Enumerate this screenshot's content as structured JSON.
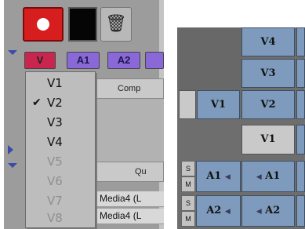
{
  "toolbar": {
    "record_icon": "record-icon",
    "trash_icon": "trash-icon",
    "trash_glyph": "🗑"
  },
  "tracks": {
    "video": "V",
    "audio1": "A1",
    "audio2": "A2"
  },
  "columns": {
    "comp": "Comp",
    "qu": "Qu"
  },
  "dropdown": {
    "checked_glyph": "✔",
    "items": [
      {
        "label": "V1",
        "enabled": true,
        "checked": false
      },
      {
        "label": "V2",
        "enabled": true,
        "checked": true
      },
      {
        "label": "V3",
        "enabled": true,
        "checked": false
      },
      {
        "label": "V4",
        "enabled": true,
        "checked": false
      },
      {
        "label": "V5",
        "enabled": false,
        "checked": false
      },
      {
        "label": "V6",
        "enabled": false,
        "checked": false
      },
      {
        "label": "V7",
        "enabled": false,
        "checked": false
      },
      {
        "label": "V8",
        "enabled": false,
        "checked": false
      }
    ]
  },
  "media_rows": [
    "Media4 (L",
    "Media4 (L"
  ],
  "track_panel": {
    "v4": "V4",
    "v3": "V3",
    "v2": "V2",
    "v1_source": "V1",
    "v1_record": "V1",
    "a1_source": "A1",
    "a1_record": "A1",
    "a2_source": "A2",
    "a2_record": "A2",
    "solo": "S",
    "mute": "M",
    "speaker_glyph": "◀"
  },
  "colors": {
    "record": "#d61e1e",
    "video_track": "#c8264f",
    "audio_track": "#8a68d8",
    "track_panel_blue": "#7e9bbd"
  }
}
